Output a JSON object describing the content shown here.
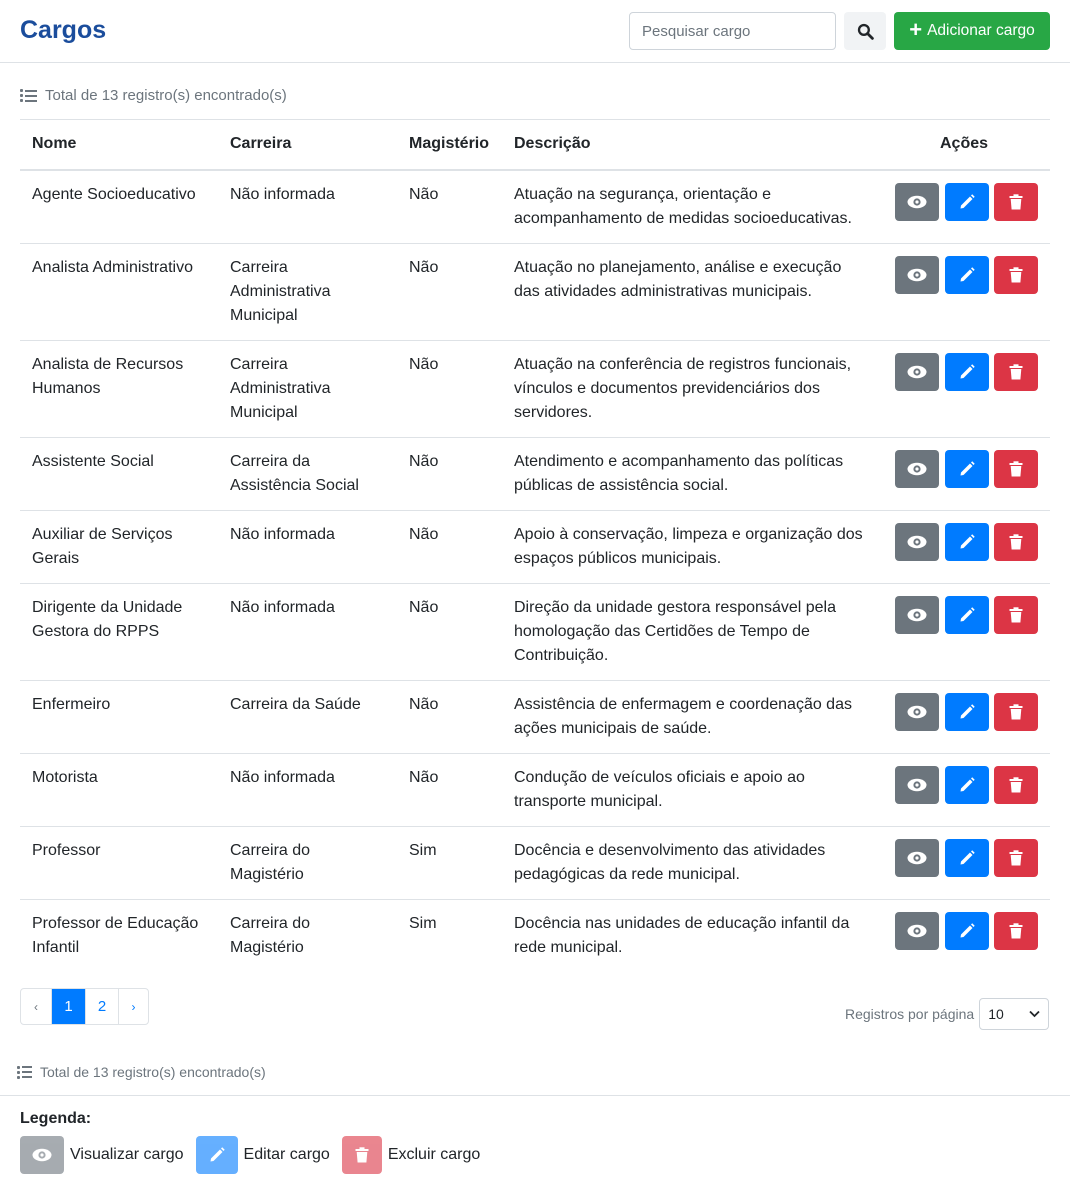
{
  "header": {
    "title": "Cargos",
    "search_placeholder": "Pesquisar cargo",
    "add_label": "Adicionar cargo"
  },
  "summary": {
    "total_text": "Total de 13 registro(s) encontrado(s)"
  },
  "table": {
    "columns": [
      "Nome",
      "Carreira",
      "Magistério",
      "Descrição",
      "Ações"
    ],
    "rows": [
      {
        "nome": "Agente Socioeducativo",
        "carreira": "Não informada",
        "magisterio": "Não",
        "descricao": "Atuação na segurança, orientação e acompanhamento de medidas socioeducativas."
      },
      {
        "nome": "Analista Administrativo",
        "carreira": "Carreira Administrativa Municipal",
        "magisterio": "Não",
        "descricao": "Atuação no planejamento, análise e execução das atividades administrativas municipais."
      },
      {
        "nome": "Analista de Recursos Humanos",
        "carreira": "Carreira Administrativa Municipal",
        "magisterio": "Não",
        "descricao": "Atuação na conferência de registros funcionais, vínculos e documentos previdenciários dos servidores."
      },
      {
        "nome": "Assistente Social",
        "carreira": "Carreira da Assistência Social",
        "magisterio": "Não",
        "descricao": "Atendimento e acompanhamento das políticas públicas de assistência social."
      },
      {
        "nome": "Auxiliar de Serviços Gerais",
        "carreira": "Não informada",
        "magisterio": "Não",
        "descricao": "Apoio à conservação, limpeza e organização dos espaços públicos municipais."
      },
      {
        "nome": "Dirigente da Unidade Gestora do RPPS",
        "carreira": "Não informada",
        "magisterio": "Não",
        "descricao": "Direção da unidade gestora responsável pela homologação das Certidões de Tempo de Contribuição."
      },
      {
        "nome": "Enfermeiro",
        "carreira": "Carreira da Saúde",
        "magisterio": "Não",
        "descricao": "Assistência de enfermagem e coordenação das ações municipais de saúde."
      },
      {
        "nome": "Motorista",
        "carreira": "Não informada",
        "magisterio": "Não",
        "descricao": "Condução de veículos oficiais e apoio ao transporte municipal."
      },
      {
        "nome": "Professor",
        "carreira": "Carreira do Magistério",
        "magisterio": "Sim",
        "descricao": "Docência e desenvolvimento das atividades pedagógicas da rede municipal."
      },
      {
        "nome": "Professor de Educação Infantil",
        "carreira": "Carreira do Magistério",
        "magisterio": "Sim",
        "descricao": "Docência nas unidades de educação infantil da rede municipal."
      }
    ]
  },
  "pagination": {
    "prev": "‹",
    "pages": [
      "1",
      "2"
    ],
    "current": "1",
    "next": "›",
    "per_page_label": "Registros por página",
    "per_page_value": "10"
  },
  "legend": {
    "title": "Legenda:",
    "view": "Visualizar cargo",
    "edit": "Editar cargo",
    "delete": "Excluir cargo"
  },
  "colors": {
    "title": "#1b4d9c",
    "view": "#6c757d",
    "edit": "#007bff",
    "delete": "#dc3545",
    "add": "#28a745"
  },
  "icons": {
    "search": "search-icon",
    "add": "plus-icon",
    "view": "eye-icon",
    "edit": "pencil-icon",
    "delete": "trash-icon",
    "list": "list-icon"
  }
}
